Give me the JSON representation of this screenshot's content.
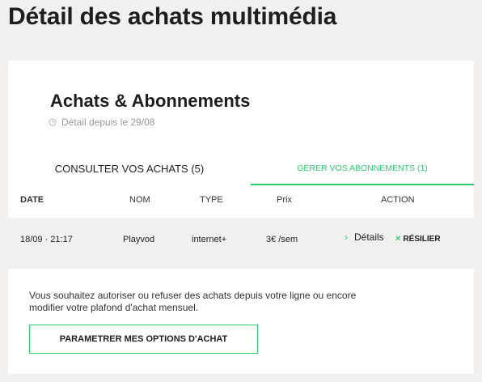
{
  "page": {
    "title": "Détail des achats multimédia"
  },
  "section": {
    "title": "Achats & Abonnements",
    "since": "Détail depuis le 29/08"
  },
  "tabs": [
    {
      "label": "CONSULTER VOS ACHATS (5)",
      "active": false
    },
    {
      "label": "GÉRER VOS ABONNEMENTS (1)",
      "active": true
    }
  ],
  "table": {
    "headers": {
      "date": "DATE",
      "nom": "NOM",
      "type": "TYPE",
      "prix": "Prix",
      "action": "ACTION"
    },
    "rows": [
      {
        "date": "18/09 · 21:17",
        "nom": "Playvod",
        "type": "internet+",
        "prix": "3€ /sem",
        "details": "Détails",
        "resilier": "RÉSILIER"
      }
    ]
  },
  "options": {
    "text": "Vous souhaitez autoriser ou refuser des achats depuis votre ligne ou encore modifier votre plafond d'achat mensuel.",
    "button": "PARAMETRER MES OPTIONS D'ACHAT"
  },
  "icons": {
    "clock": "clock-icon",
    "chevron": "chevron-right-icon",
    "close": "close-icon"
  },
  "colors": {
    "accent": "#2ecc71",
    "background": "#f1f0ee",
    "text": "#1e1e1e"
  }
}
